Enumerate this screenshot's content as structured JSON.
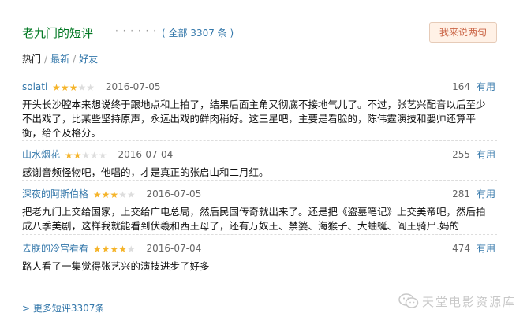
{
  "header": {
    "title": "老九门的短评",
    "dots": "· · · · · ·",
    "count": "( 全部 3307 条 )",
    "write_button": "我来说两句"
  },
  "tabs": {
    "hot": "热门",
    "latest": "最新",
    "friends": "好友",
    "separator": "/"
  },
  "comments": [
    {
      "user": "solati",
      "rating": 3,
      "date": "2016-07-05",
      "votes": "164",
      "useful_label": "有用",
      "text": "开头长沙腔本来想说终于跟地点和上拍了，结果后面主角又彻底不接地气儿了。不过，张艺兴配音以后至少不出戏了，比某些坚持原声，永远出戏的鲜肉稍好。这三星吧，主要是看脸的，陈伟霆演技和娶帅还算平衡，给个及格分。"
    },
    {
      "user": "山水烟花",
      "rating": 2,
      "date": "2016-07-04",
      "votes": "255",
      "useful_label": "有用",
      "text": "感谢音频怪物吧，他唱的，才是真正的张启山和二月红。"
    },
    {
      "user": "深夜的阿斯伯格",
      "rating": 3,
      "date": "2016-07-05",
      "votes": "281",
      "useful_label": "有用",
      "text": "把老九门上交给国家，上交给广电总局，然后民国传奇就出来了。还是把《盗墓笔记》上交美帝吧，然后拍成八季美剧，这样我就能看到伏羲和西王母了，还有万奴王、禁婆、海猴子、大蚰蜒、阎王骑尸.妈的"
    },
    {
      "user": "去朕的冷宫看看",
      "rating": 4,
      "date": "2016-07-04",
      "votes": "474",
      "useful_label": "有用",
      "text": "路人看了一集觉得张艺兴的演技进步了好多"
    }
  ],
  "more_link": "> 更多短评3307条",
  "watermark": {
    "text": "天堂电影资源库",
    "icon": "wechat-icon"
  },
  "colors": {
    "green_title": "#007722",
    "link": "#3377aa",
    "star_on": "#f5b42a",
    "star_off": "#dddddd",
    "button_bg": "#fff1e6",
    "button_text": "#ca6445"
  }
}
